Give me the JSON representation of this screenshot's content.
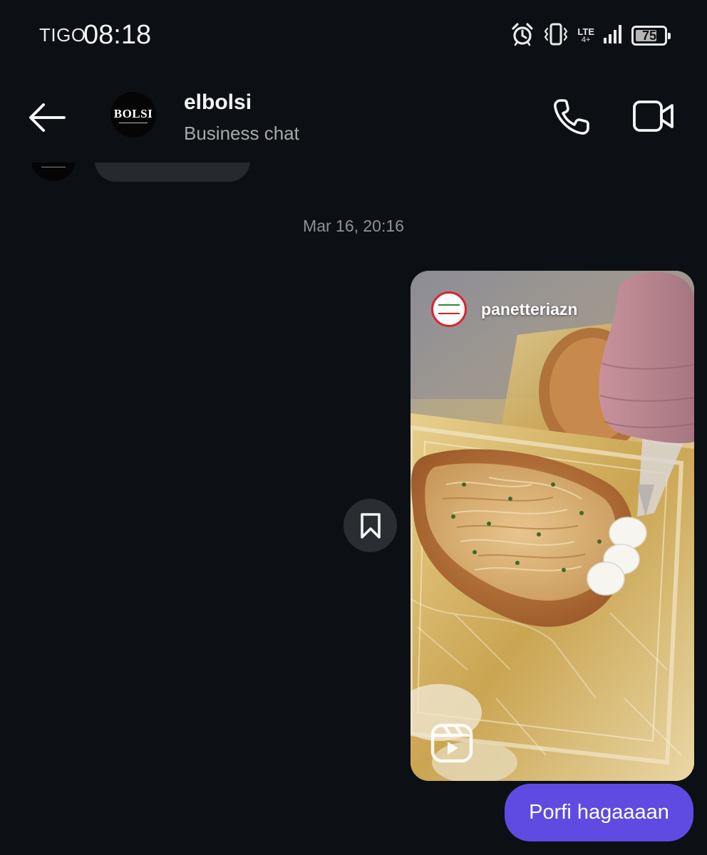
{
  "status_bar": {
    "carrier": "TIGO",
    "time": "08:18",
    "network": "LTE",
    "network_sub": "4+",
    "battery_percent": 75,
    "battery_label": "75",
    "icons": [
      "alarm-icon",
      "vibrate-icon",
      "signal-icon",
      "battery-icon"
    ]
  },
  "header": {
    "title": "elbolsi",
    "subtitle": "Business chat",
    "avatar_text": "BOLSI",
    "icons": [
      "back-arrow-icon",
      "phone-icon",
      "video-camera-icon"
    ]
  },
  "timestamp": "Mar 16, 20:16",
  "shared_reel": {
    "author": "panetteriazn",
    "icons": [
      "bookmark-icon",
      "reels-icon"
    ]
  },
  "sent_message": "Porfi hagaaaan",
  "colors": {
    "background": "#0c1014",
    "sent_bubble": "#5f4be1",
    "received_bubble": "#262a2f",
    "muted_text": "#a8a8a8"
  }
}
